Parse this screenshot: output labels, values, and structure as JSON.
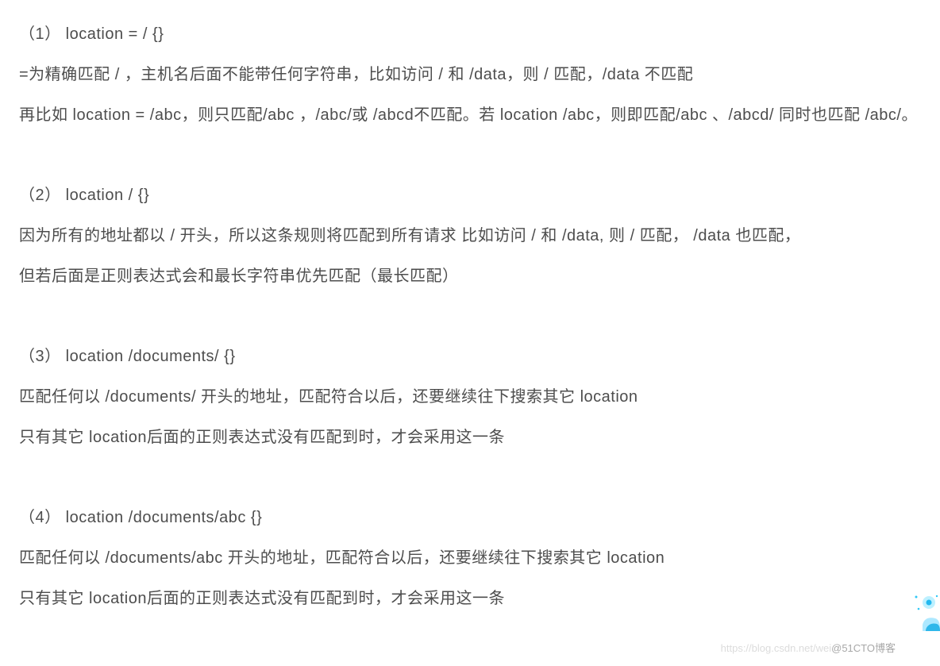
{
  "sections": [
    {
      "lines": [
        "（1） location = / {}",
        "=为精确匹配 / ，主机名后面不能带任何字符串，比如访问 / 和 /data，则 / 匹配，/data 不匹配",
        "再比如 location = /abc，则只匹配/abc ，/abc/或 /abcd不匹配。若 location /abc，则即匹配/abc 、/abcd/ 同时也匹配 /abc/。"
      ]
    },
    {
      "lines": [
        "（2） location / {}",
        "因为所有的地址都以 / 开头，所以这条规则将匹配到所有请求 比如访问 / 和 /data, 则 / 匹配， /data 也匹配，",
        "但若后面是正则表达式会和最长字符串优先匹配（最长匹配）"
      ]
    },
    {
      "lines": [
        "（3） location /documents/ {}",
        "匹配任何以 /documents/ 开头的地址，匹配符合以后，还要继续往下搜索其它 location",
        "只有其它 location后面的正则表达式没有匹配到时，才会采用这一条"
      ]
    },
    {
      "lines": [
        "（4） location /documents/abc {}",
        "匹配任何以 /documents/abc 开头的地址，匹配符合以后，还要继续往下搜索其它 location",
        "只有其它 location后面的正则表达式没有匹配到时，才会采用这一条"
      ]
    }
  ],
  "watermark": {
    "faint": "https://blog.csdn.net/wei",
    "handle": "@51CTO博客"
  }
}
